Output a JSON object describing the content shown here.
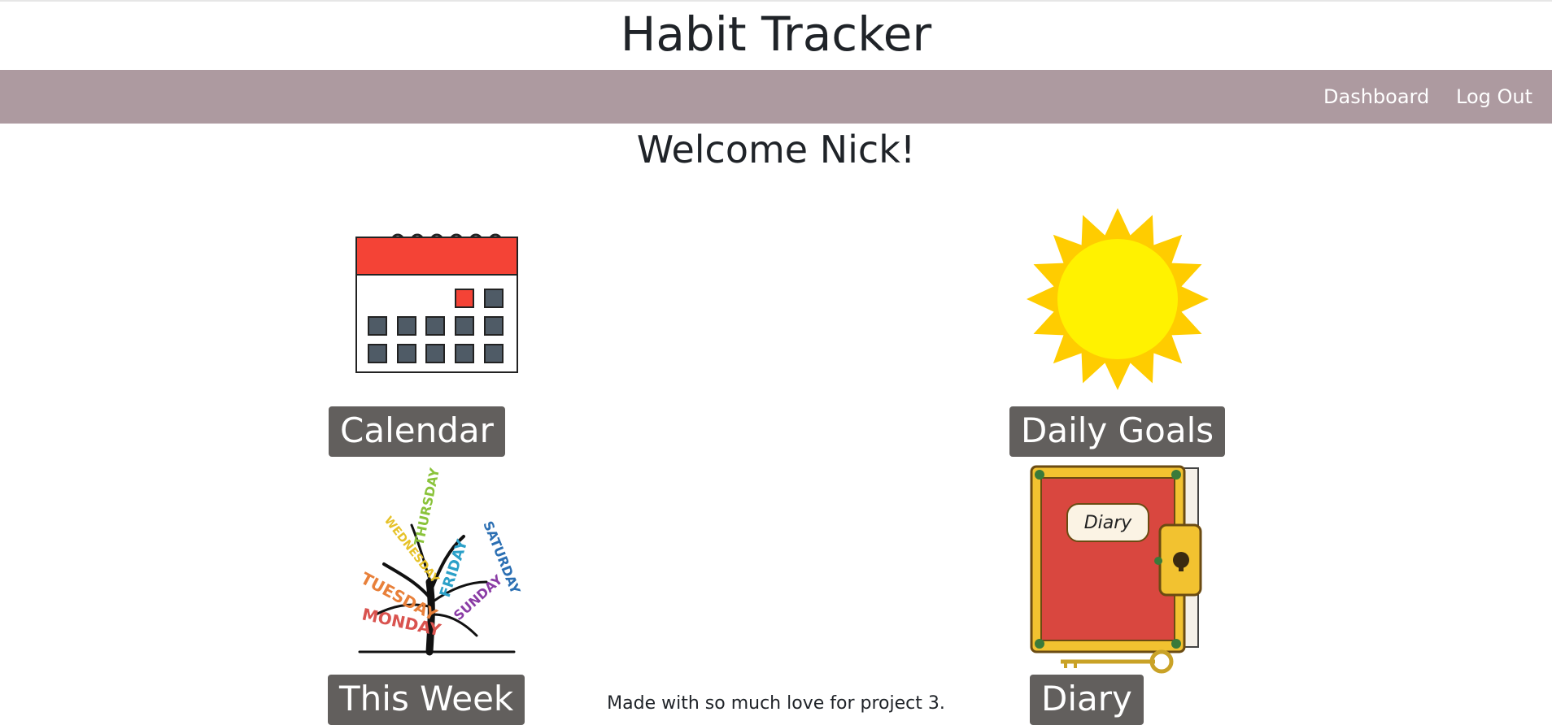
{
  "header": {
    "title": "Habit Tracker"
  },
  "nav": {
    "dashboard": "Dashboard",
    "logout": "Log Out",
    "background_color": "#ad9aa0"
  },
  "main": {
    "welcome": "Welcome Nick!",
    "tiles": [
      {
        "label": "Calendar",
        "icon": "calendar-icon"
      },
      {
        "label": "Daily Goals",
        "icon": "sun-icon"
      },
      {
        "label": "This Week",
        "icon": "weekday-tree-icon"
      },
      {
        "label": "Diary",
        "icon": "diary-book-icon"
      }
    ],
    "tree_words": [
      "MONDAY",
      "TUESDAY",
      "WEDNESDAY",
      "THURSDAY",
      "FRIDAY",
      "SATURDAY",
      "SUNDAY"
    ],
    "diary_cover_text": "Diary",
    "label_background": "#625f5d"
  },
  "footer": {
    "text": "Made with so much love for project 3."
  }
}
